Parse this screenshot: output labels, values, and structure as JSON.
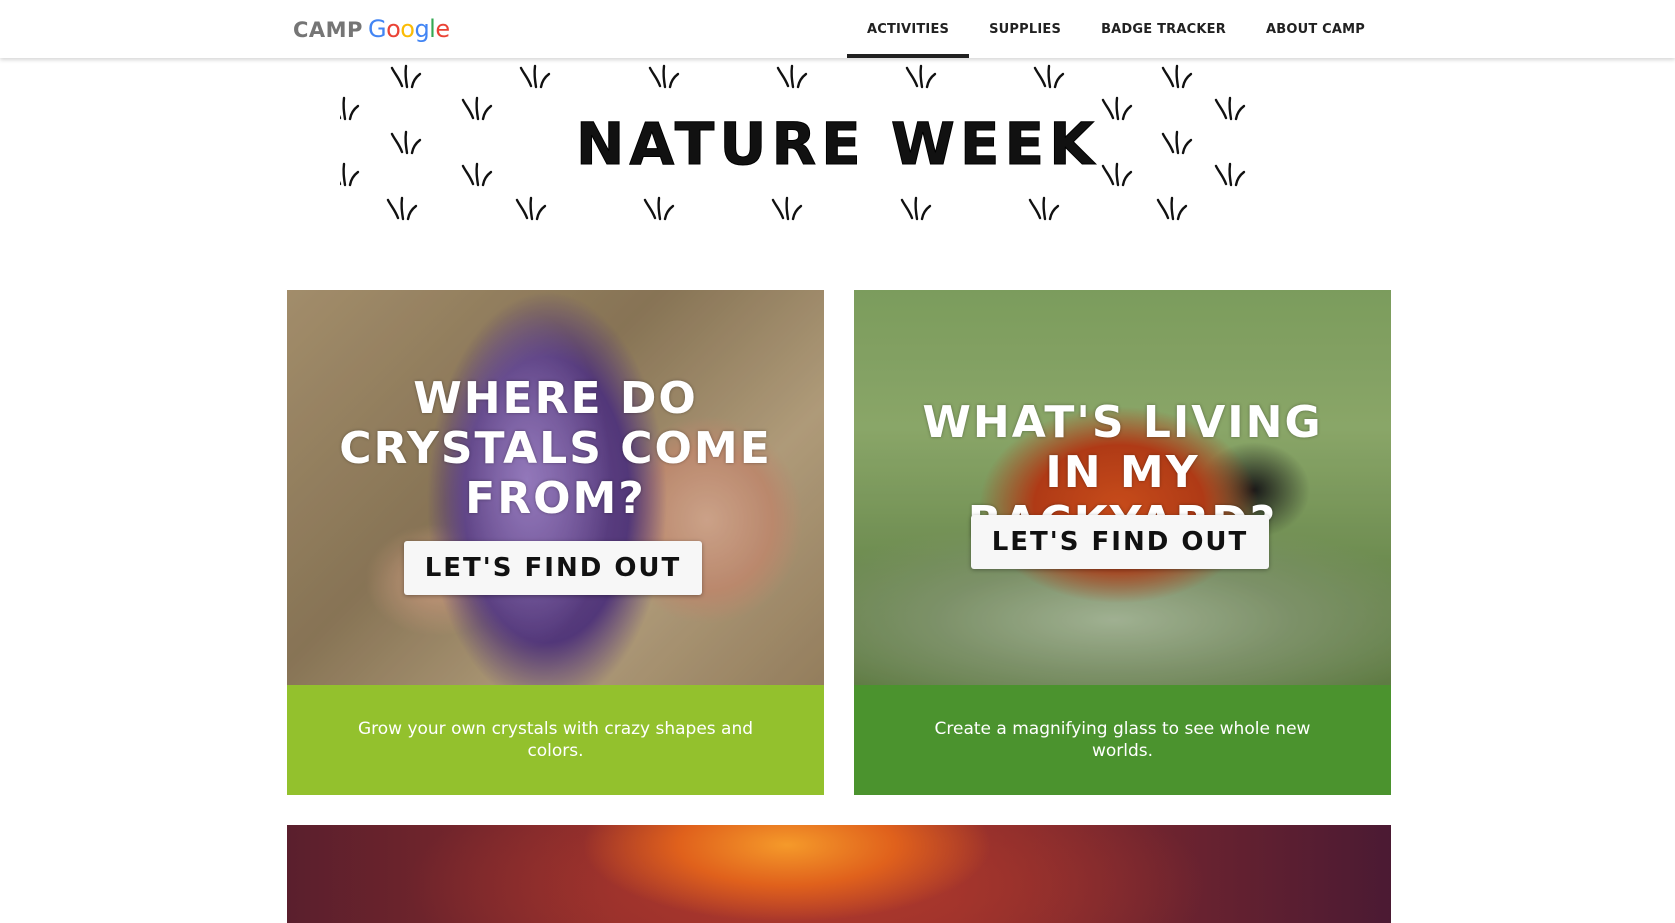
{
  "header": {
    "logo": {
      "camp": "CAMP",
      "google_letters": [
        {
          "char": "G",
          "color": "#4285F4"
        },
        {
          "char": "o",
          "color": "#EA4335"
        },
        {
          "char": "o",
          "color": "#FBBC05"
        },
        {
          "char": "g",
          "color": "#4285F4"
        },
        {
          "char": "l",
          "color": "#34A853"
        },
        {
          "char": "e",
          "color": "#EA4335"
        }
      ]
    },
    "nav": [
      {
        "label": "ACTIVITIES",
        "active": true
      },
      {
        "label": "SUPPLIES",
        "active": false
      },
      {
        "label": "BADGE TRACKER",
        "active": false
      },
      {
        "label": "ABOUT CAMP",
        "active": false
      }
    ]
  },
  "hero": {
    "title": "NATURE WEEK",
    "decoration_icon": "grass-tuft-icon"
  },
  "cards": [
    {
      "heading": "WHERE DO CRYSTALS COME FROM?",
      "button": "LET'S FIND OUT",
      "caption": "Grow your own crystals with crazy shapes and colors.",
      "caption_color": "#93c12d",
      "photo": "amethyst-crystal-in-hand"
    },
    {
      "heading": "WHAT'S LIVING IN MY BACKYARD?",
      "button": "LET'S FIND OUT",
      "caption": "Create a magnifying glass to see whole new worlds.",
      "caption_color": "#4b932e",
      "photo": "ladybug-on-leaf"
    }
  ],
  "next_card": {
    "photo": "sunset-glow"
  }
}
